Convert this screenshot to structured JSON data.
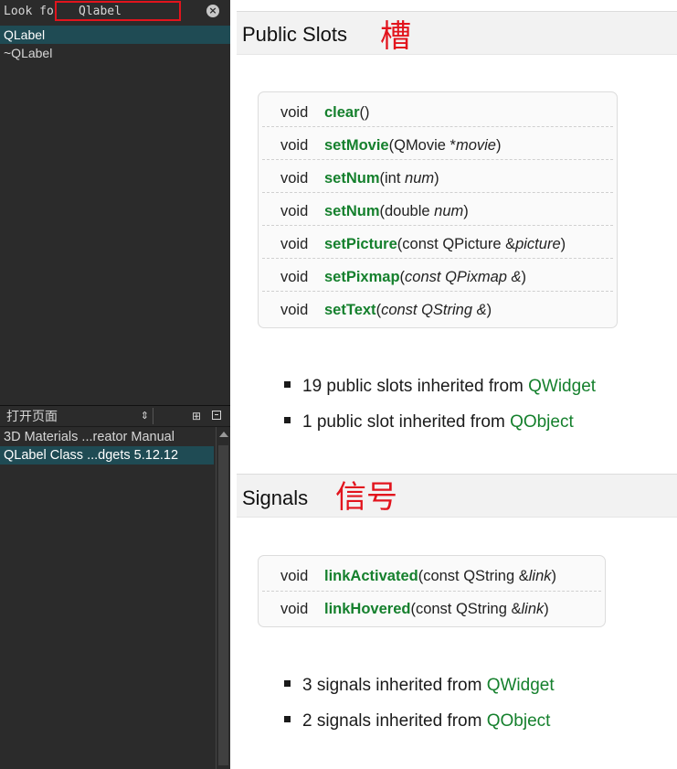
{
  "search": {
    "label": "Look for:",
    "value": "Qlabel",
    "clear_glyph": "×",
    "results": [
      "QLabel",
      "~QLabel"
    ]
  },
  "open_pages": {
    "title": "打开页面",
    "arrow": "⇕",
    "split_glyph": "⊞",
    "items": [
      "3D Materials ...reator Manual",
      "QLabel Class ...dgets 5.12.12"
    ]
  },
  "public_slots": {
    "title": "Public Slots",
    "annotation": "槽",
    "rows": [
      {
        "ret": "void",
        "fn": "clear",
        "pre": "()",
        "arg": "",
        "post": ""
      },
      {
        "ret": "void",
        "fn": "setMovie",
        "pre": "(QMovie *",
        "arg": "movie",
        "post": ")"
      },
      {
        "ret": "void",
        "fn": "setNum",
        "pre": "(int ",
        "arg": "num",
        "post": ")"
      },
      {
        "ret": "void",
        "fn": "setNum",
        "pre": "(double ",
        "arg": "num",
        "post": ")"
      },
      {
        "ret": "void",
        "fn": "setPicture",
        "pre": "(const QPicture &",
        "arg": "picture",
        "post": ")"
      },
      {
        "ret": "void",
        "fn": "setPixmap",
        "pre": "(",
        "arg": "const QPixmap &",
        "post": ")"
      },
      {
        "ret": "void",
        "fn": "setText",
        "pre": "(",
        "arg": "const QString &",
        "post": ")"
      }
    ],
    "inherited": [
      {
        "text": "19 public slots inherited from ",
        "link": "QWidget"
      },
      {
        "text": "1 public slot inherited from ",
        "link": "QObject"
      }
    ]
  },
  "signals": {
    "title": "Signals",
    "annotation": "信号",
    "rows": [
      {
        "ret": "void",
        "fn": "linkActivated",
        "pre": "(const QString &",
        "arg": "link",
        "post": ")"
      },
      {
        "ret": "void",
        "fn": "linkHovered",
        "pre": "(const QString &",
        "arg": "link",
        "post": ")"
      }
    ],
    "inherited": [
      {
        "text": "3 signals inherited from ",
        "link": "QWidget"
      },
      {
        "text": "2 signals inherited from ",
        "link": "QObject"
      }
    ]
  },
  "colors": {
    "sidebar_bg": "#2b2b2b",
    "selection": "#1f4b54",
    "link_green": "#15802d",
    "annotation_red": "#e2141d"
  }
}
